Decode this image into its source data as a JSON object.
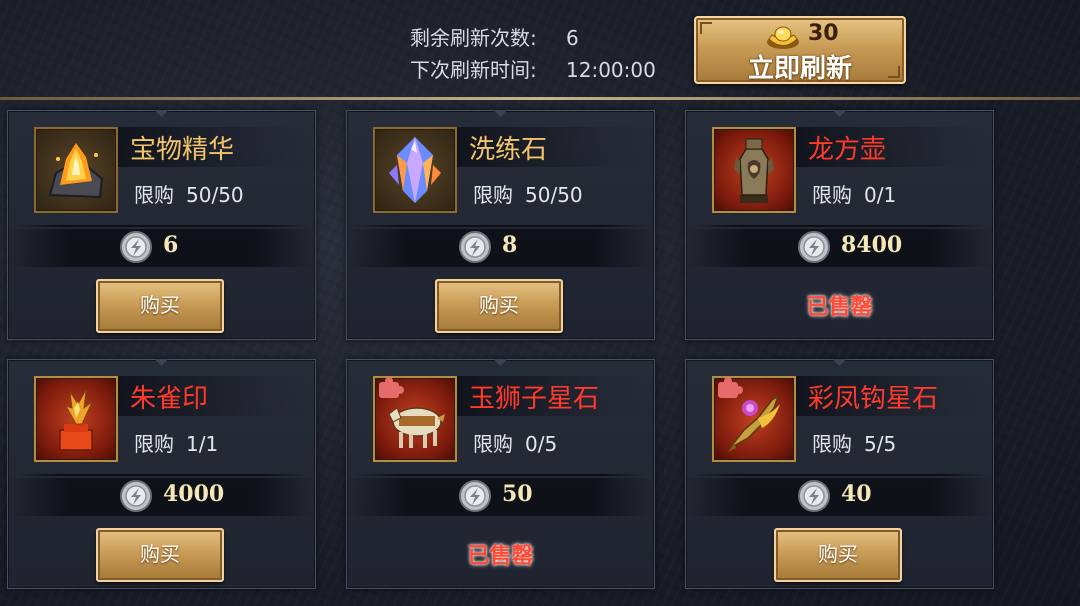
{
  "header": {
    "remaining_label": "剩余刷新次数:",
    "remaining_value": "6",
    "next_label": "下次刷新时间:",
    "next_value": "12:00:00",
    "refresh_cost": "30",
    "refresh_label": "立即刷新",
    "refresh_cost_icon": "gold-ingot-icon"
  },
  "colors": {
    "name_gold": "#f2c56b",
    "name_red": "#ff3a2a",
    "sold_red": "#ff4a36",
    "price_text": "#f5e7b8"
  },
  "items": [
    {
      "name": "宝物精华",
      "name_color": "gold",
      "limit_label": "限购",
      "limit": "50/50",
      "price": "6",
      "action": "购买",
      "sold_out": false,
      "icon": "treasure-essence-icon",
      "currency_icon": "silver-coin-icon"
    },
    {
      "name": "洗练石",
      "name_color": "gold",
      "limit_label": "限购",
      "limit": "50/50",
      "price": "8",
      "action": "购买",
      "sold_out": false,
      "icon": "refining-stone-icon",
      "currency_icon": "silver-coin-icon"
    },
    {
      "name": "龙方壶",
      "name_color": "red",
      "limit_label": "限购",
      "limit": "0/1",
      "price": "8400",
      "action": "已售罄",
      "sold_out": true,
      "icon": "dragon-pot-icon",
      "currency_icon": "silver-coin-icon"
    },
    {
      "name": "朱雀印",
      "name_color": "red",
      "limit_label": "限购",
      "limit": "1/1",
      "price": "4000",
      "action": "购买",
      "sold_out": false,
      "icon": "vermilion-bird-seal-icon",
      "currency_icon": "silver-coin-icon"
    },
    {
      "name": "玉狮子星石",
      "name_color": "red",
      "limit_label": "限购",
      "limit": "0/5",
      "price": "50",
      "action": "已售罄",
      "sold_out": true,
      "icon": "jade-lion-starstone-icon",
      "currency_icon": "silver-coin-icon",
      "fragment": true
    },
    {
      "name": "彩凤钩星石",
      "name_color": "red",
      "limit_label": "限购",
      "limit": "5/5",
      "price": "40",
      "action": "购买",
      "sold_out": false,
      "icon": "phoenix-hook-starstone-icon",
      "currency_icon": "silver-coin-icon",
      "fragment": true
    }
  ]
}
